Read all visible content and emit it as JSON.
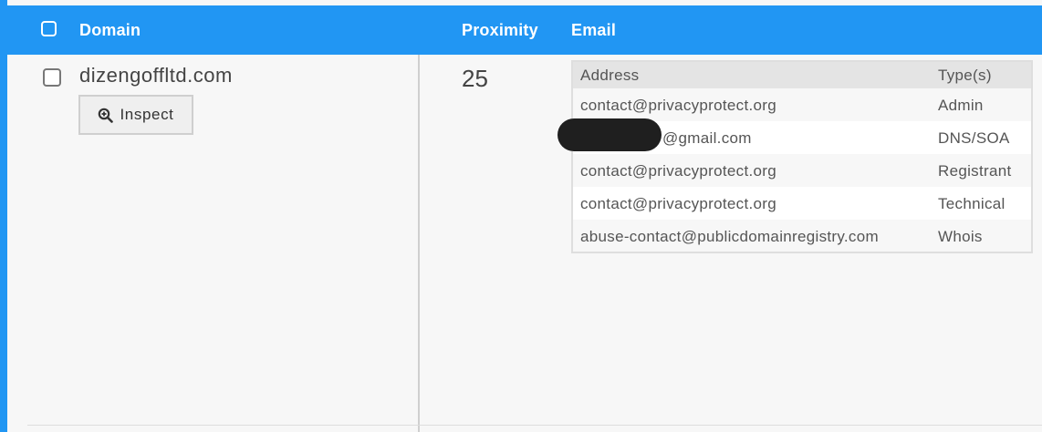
{
  "header": {
    "domain_label": "Domain",
    "proximity_label": "Proximity",
    "email_label": "Email"
  },
  "row": {
    "domain": "dizengoffltd.com",
    "inspect_label": "Inspect",
    "proximity": "25"
  },
  "email_table": {
    "columns": [
      "Address",
      "Type(s)"
    ],
    "rows": [
      {
        "address": "contact@privacyprotect.org",
        "type": "Admin"
      },
      {
        "address": "@gmail.com",
        "type": "DNS/SOA",
        "redacted_prefix": true
      },
      {
        "address": "contact@privacyprotect.org",
        "type": "Registrant"
      },
      {
        "address": "contact@privacyprotect.org",
        "type": "Technical"
      },
      {
        "address": "abuse-contact@publicdomainregistry.com",
        "type": "Whois"
      }
    ]
  },
  "colors": {
    "accent": "#2196f3",
    "background": "#f7f7f7",
    "redaction": "#1f1f1f"
  },
  "icons": {
    "header_checkbox": "checkbox-icon",
    "row_checkbox": "checkbox-icon",
    "inspect": "magnify-plus-icon"
  }
}
